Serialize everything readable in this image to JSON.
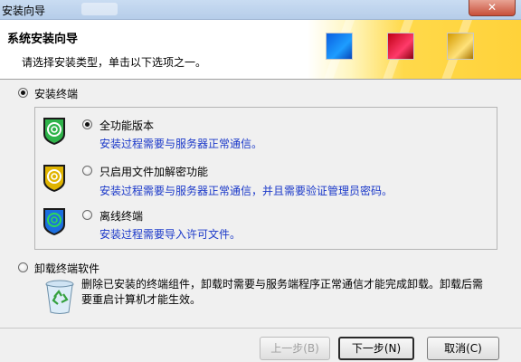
{
  "window": {
    "title": "安装向导",
    "close_glyph": "✕"
  },
  "header": {
    "title": "系统安装向导",
    "subtitle": "请选择安装类型，单击以下选项之一。"
  },
  "install_terminal": {
    "label": "安装终端",
    "checked": true,
    "options": [
      {
        "label": "全功能版本",
        "desc": "安装过程需要与服务器正常通信。",
        "checked": true,
        "icon": "shield-green-icon"
      },
      {
        "label": "只启用文件加解密功能",
        "desc": "安装过程需要与服务器正常通信，并且需要验证管理员密码。",
        "checked": false,
        "icon": "shield-yellow-icon"
      },
      {
        "label": "离线终端",
        "desc": "安装过程需要导入许可文件。",
        "checked": false,
        "icon": "shield-blue-icon"
      }
    ]
  },
  "uninstall": {
    "label": "卸载终端软件",
    "checked": false,
    "text": "删除已安装的终端组件，卸载时需要与服务端程序正常通信才能完成卸载。卸载后需要重启计算机才能生效。",
    "icon": "recycle-bin-icon"
  },
  "buttons": {
    "back": "上一步(B)",
    "next": "下一步(N)",
    "cancel": "取消(C)"
  }
}
